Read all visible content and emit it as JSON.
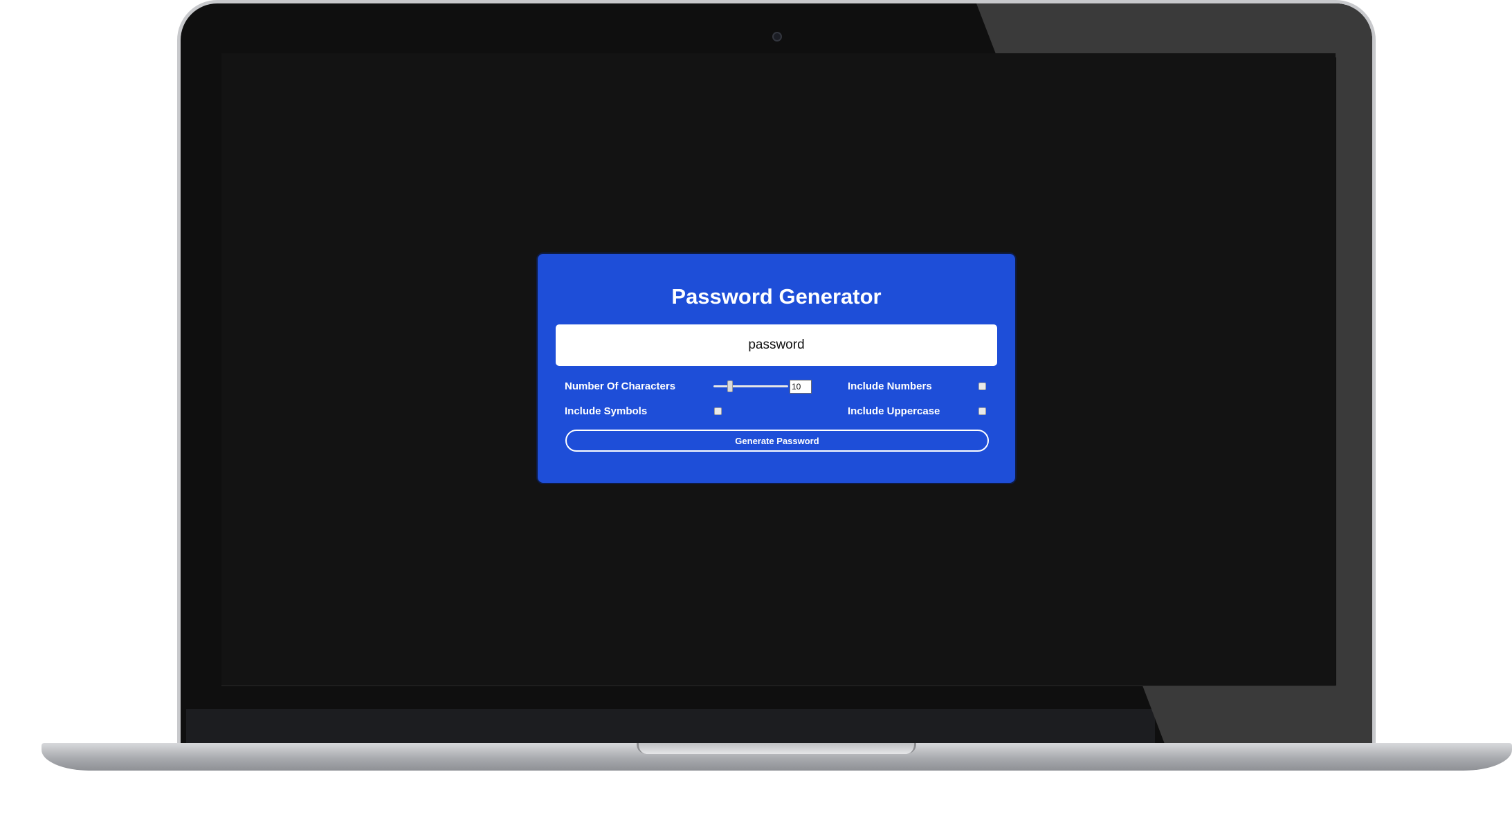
{
  "app": {
    "title": "Password Generator",
    "password_value": "password",
    "button_label": "Generate Password",
    "accent_color": "#1e4ed8"
  },
  "options": {
    "characters_label": "Number Of Characters",
    "characters_value": "10",
    "characters_slider_level": 0.2,
    "numbers_label": "Include Numbers",
    "numbers_checked": false,
    "symbols_label": "Include Symbols",
    "symbols_checked": false,
    "uppercase_label": "Include Uppercase",
    "uppercase_checked": false
  },
  "device": {
    "type": "laptop-mockup",
    "screen_background": "#131313"
  }
}
